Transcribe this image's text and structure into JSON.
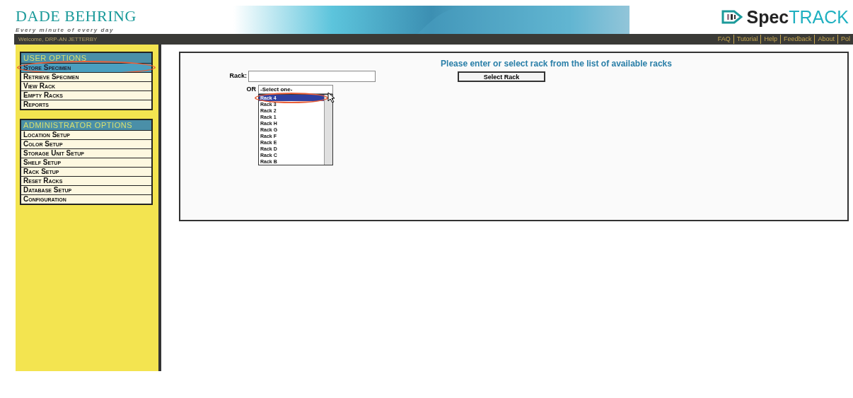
{
  "header": {
    "brand": "DADE BEHRING",
    "tagline": "Every minute of every day",
    "product_prefix": "Spec",
    "product_suffix": "TRACK"
  },
  "top_bar": {
    "welcome": "Welcome, DRP-AN JETTERBY",
    "links": [
      "FAQ",
      "Tutorial",
      "Help",
      "Feedback",
      "About",
      "Pol"
    ]
  },
  "sidebar": {
    "sections": [
      {
        "title": "USER OPTIONS",
        "items": [
          {
            "label": "Store Specimen",
            "selected": true,
            "circled": true
          },
          {
            "label": "Retrieve Specimen",
            "selected": false,
            "circled": false
          },
          {
            "label": "View Rack",
            "selected": false,
            "circled": false
          },
          {
            "label": "Empty Racks",
            "selected": false,
            "circled": false
          },
          {
            "label": "Reports",
            "selected": false,
            "circled": false
          }
        ]
      },
      {
        "title": "ADMINISTRATOR OPTIONS",
        "items": [
          {
            "label": "Location Setup",
            "selected": false,
            "circled": false
          },
          {
            "label": "Color Setup",
            "selected": false,
            "circled": false
          },
          {
            "label": "Storage Unit Setup",
            "selected": false,
            "circled": false
          },
          {
            "label": "Shelf Setup",
            "selected": false,
            "circled": false
          },
          {
            "label": "Rack Setup",
            "selected": false,
            "circled": false
          },
          {
            "label": "Reset Racks",
            "selected": false,
            "circled": false
          },
          {
            "label": "Database Setup",
            "selected": false,
            "circled": false
          },
          {
            "label": "Configuration",
            "selected": false,
            "circled": false
          }
        ]
      }
    ]
  },
  "main": {
    "heading": "Please enter or select rack from the list of available racks",
    "rack_label": "Rack:",
    "select_button": "Select Rack",
    "or_label": "OR",
    "dropdown_value": "-Select one-",
    "options": [
      {
        "label": "Rack 4",
        "selected": true
      },
      {
        "label": "Rack 3",
        "selected": false
      },
      {
        "label": "Rack 2",
        "selected": false
      },
      {
        "label": "Rack 1",
        "selected": false
      },
      {
        "label": "Rack H",
        "selected": false
      },
      {
        "label": "Rack G",
        "selected": false
      },
      {
        "label": "Rack F",
        "selected": false
      },
      {
        "label": "Rack E",
        "selected": false
      },
      {
        "label": "Rack D",
        "selected": false
      },
      {
        "label": "Rack C",
        "selected": false
      },
      {
        "label": "Rack B",
        "selected": false
      }
    ]
  }
}
